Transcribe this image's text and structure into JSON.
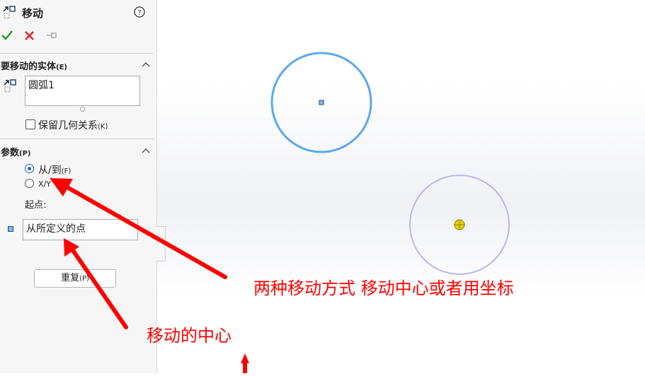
{
  "panel": {
    "title": "移动",
    "help_icon": "help-circle-icon",
    "actions": {
      "ok_icon": "checkmark-icon",
      "cancel_icon": "close-icon",
      "pin_icon": "pushpin-icon",
      "ok_color": "#2e9a2e",
      "cancel_color": "#d62020"
    },
    "entities_section": {
      "heading": "要移动的实体",
      "heading_key": "(E)",
      "list_items": [
        "圆弧1"
      ],
      "keep_relations_label": "保留几何关系",
      "keep_relations_key": "(K)",
      "keep_relations_checked": false
    },
    "params_section": {
      "heading": "参数",
      "heading_key": "(P)",
      "option_from_to": "从/到",
      "option_from_to_key": "(F)",
      "option_xy": "X/Y",
      "selected_option": "from_to",
      "start_point_label": "起点:",
      "start_point_value": "从所定义的点"
    },
    "repeat_button": "重复",
    "repeat_key": "(P)"
  },
  "annotations": {
    "text_move_methods": "两种移动方式 移动中心或者用坐标",
    "text_move_center": "移动的中心",
    "color": "#ff0000"
  },
  "canvas": {
    "circle_color": "#5aa8ee",
    "preview_circle_color": "#b8b8ef",
    "center_point_color": "#e8d400"
  }
}
